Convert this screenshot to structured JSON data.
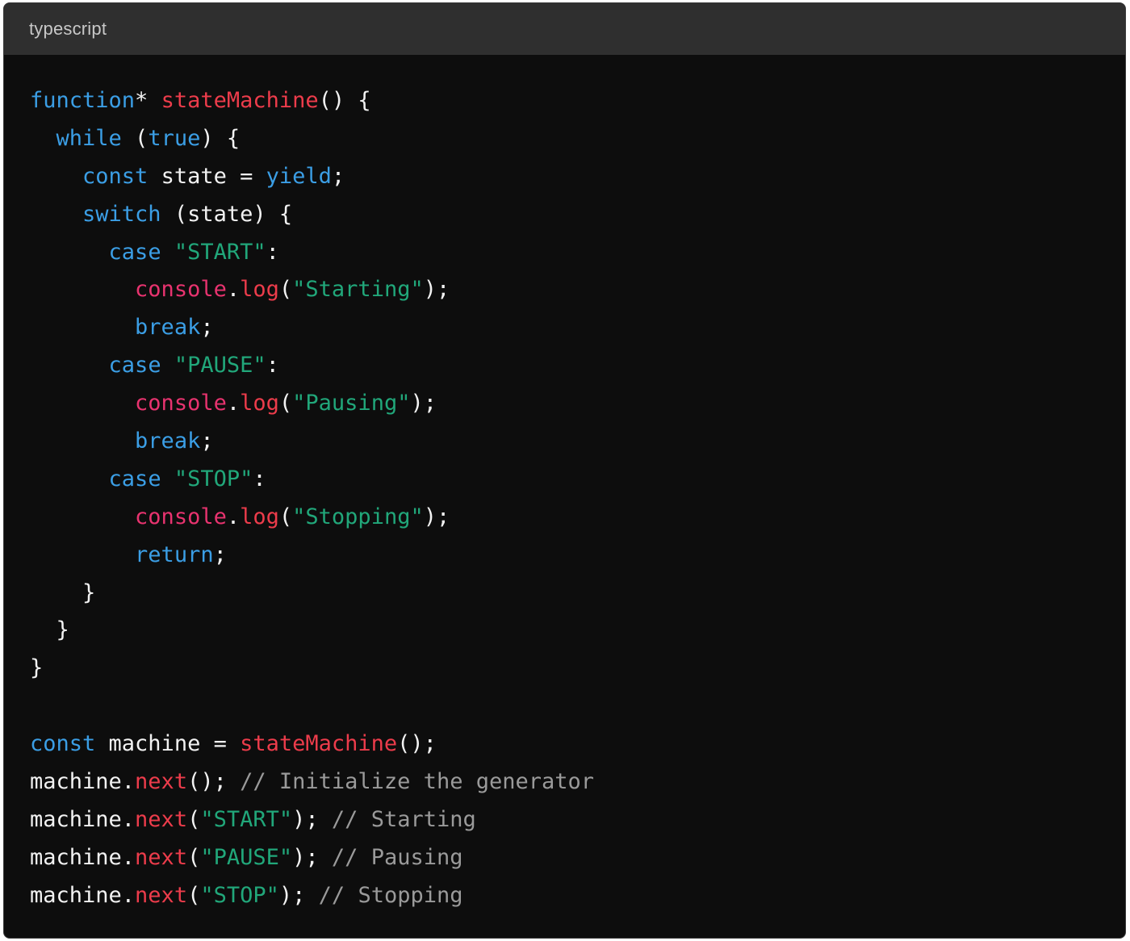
{
  "header": {
    "language": "typescript"
  },
  "colors": {
    "background": "#0d0d0d",
    "header": "#2f2f2f",
    "keyword": "#3b9ee5",
    "function": "#ec3c4b",
    "object": "#e8336f",
    "string": "#21a77a",
    "comment": "#9a9a9a",
    "plain": "#f2f2f2"
  },
  "code_lines": [
    [
      [
        "kw",
        "function"
      ],
      [
        "pl",
        "* "
      ],
      [
        "fn",
        "stateMachine"
      ],
      [
        "pl",
        "() {"
      ]
    ],
    [
      [
        "pl",
        "  "
      ],
      [
        "kw",
        "while"
      ],
      [
        "pl",
        " ("
      ],
      [
        "kw",
        "true"
      ],
      [
        "pl",
        ") {"
      ]
    ],
    [
      [
        "pl",
        "    "
      ],
      [
        "kw",
        "const"
      ],
      [
        "pl",
        " state = "
      ],
      [
        "kw",
        "yield"
      ],
      [
        "pl",
        ";"
      ]
    ],
    [
      [
        "pl",
        "    "
      ],
      [
        "kw",
        "switch"
      ],
      [
        "pl",
        " (state) {"
      ]
    ],
    [
      [
        "pl",
        "      "
      ],
      [
        "kw",
        "case"
      ],
      [
        "pl",
        " "
      ],
      [
        "str",
        "\"START\""
      ],
      [
        "pl",
        ":"
      ]
    ],
    [
      [
        "pl",
        "        "
      ],
      [
        "obj",
        "console"
      ],
      [
        "pl",
        "."
      ],
      [
        "fn",
        "log"
      ],
      [
        "pl",
        "("
      ],
      [
        "str",
        "\"Starting\""
      ],
      [
        "pl",
        ");"
      ]
    ],
    [
      [
        "pl",
        "        "
      ],
      [
        "kw",
        "break"
      ],
      [
        "pl",
        ";"
      ]
    ],
    [
      [
        "pl",
        "      "
      ],
      [
        "kw",
        "case"
      ],
      [
        "pl",
        " "
      ],
      [
        "str",
        "\"PAUSE\""
      ],
      [
        "pl",
        ":"
      ]
    ],
    [
      [
        "pl",
        "        "
      ],
      [
        "obj",
        "console"
      ],
      [
        "pl",
        "."
      ],
      [
        "fn",
        "log"
      ],
      [
        "pl",
        "("
      ],
      [
        "str",
        "\"Pausing\""
      ],
      [
        "pl",
        ");"
      ]
    ],
    [
      [
        "pl",
        "        "
      ],
      [
        "kw",
        "break"
      ],
      [
        "pl",
        ";"
      ]
    ],
    [
      [
        "pl",
        "      "
      ],
      [
        "kw",
        "case"
      ],
      [
        "pl",
        " "
      ],
      [
        "str",
        "\"STOP\""
      ],
      [
        "pl",
        ":"
      ]
    ],
    [
      [
        "pl",
        "        "
      ],
      [
        "obj",
        "console"
      ],
      [
        "pl",
        "."
      ],
      [
        "fn",
        "log"
      ],
      [
        "pl",
        "("
      ],
      [
        "str",
        "\"Stopping\""
      ],
      [
        "pl",
        ");"
      ]
    ],
    [
      [
        "pl",
        "        "
      ],
      [
        "kw",
        "return"
      ],
      [
        "pl",
        ";"
      ]
    ],
    [
      [
        "pl",
        "    }"
      ]
    ],
    [
      [
        "pl",
        "  }"
      ]
    ],
    [
      [
        "pl",
        "}"
      ]
    ],
    [],
    [
      [
        "kw",
        "const"
      ],
      [
        "pl",
        " machine = "
      ],
      [
        "fn",
        "stateMachine"
      ],
      [
        "pl",
        "();"
      ]
    ],
    [
      [
        "pl",
        "machine."
      ],
      [
        "fn",
        "next"
      ],
      [
        "pl",
        "(); "
      ],
      [
        "cm",
        "// Initialize the generator"
      ]
    ],
    [
      [
        "pl",
        "machine."
      ],
      [
        "fn",
        "next"
      ],
      [
        "pl",
        "("
      ],
      [
        "str",
        "\"START\""
      ],
      [
        "pl",
        "); "
      ],
      [
        "cm",
        "// Starting"
      ]
    ],
    [
      [
        "pl",
        "machine."
      ],
      [
        "fn",
        "next"
      ],
      [
        "pl",
        "("
      ],
      [
        "str",
        "\"PAUSE\""
      ],
      [
        "pl",
        "); "
      ],
      [
        "cm",
        "// Pausing"
      ]
    ],
    [
      [
        "pl",
        "machine."
      ],
      [
        "fn",
        "next"
      ],
      [
        "pl",
        "("
      ],
      [
        "str",
        "\"STOP\""
      ],
      [
        "pl",
        "); "
      ],
      [
        "cm",
        "// Stopping"
      ]
    ]
  ]
}
